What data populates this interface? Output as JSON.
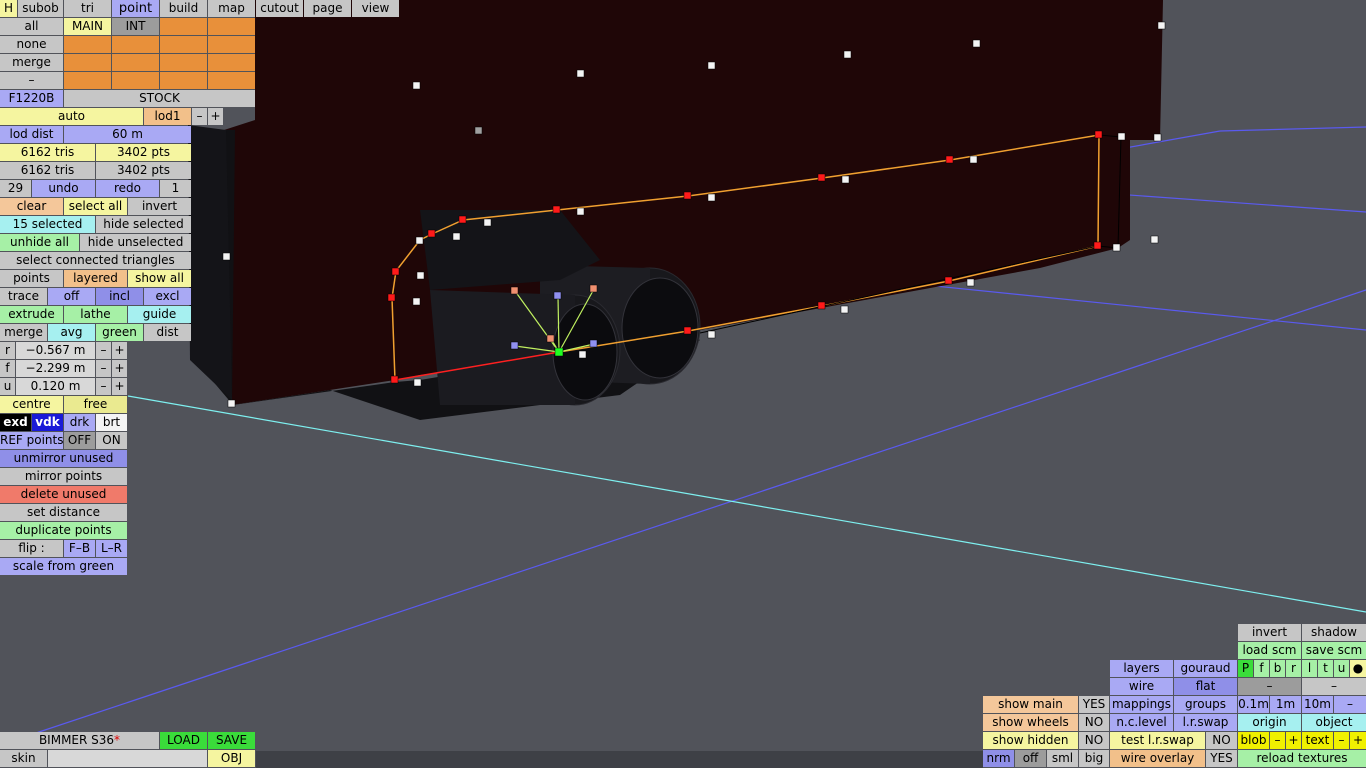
{
  "menu": {
    "items": [
      "H",
      "subob",
      "tri",
      "point",
      "build",
      "map",
      "cutout",
      "page",
      "view"
    ],
    "active": "point"
  },
  "left": {
    "sel_all": "all",
    "sel_none": "none",
    "sel_merge": "merge",
    "sel_minus": "–",
    "tab_main": "MAIN",
    "tab_int": "INT",
    "part_name": "F1220B",
    "part_type": "STOCK",
    "lod_auto": "auto",
    "lod_level": "lod1",
    "lod_minus": "–",
    "lod_plus": "+",
    "lod_dist_label": "lod dist",
    "lod_dist_value": "60 m",
    "tris1": "6162 tris",
    "pts1": "3402 pts",
    "tris2": "6162 tris",
    "pts2": "3402 pts",
    "undo_count": "29",
    "undo": "undo",
    "redo": "redo",
    "redo_count": "1",
    "clear": "clear",
    "select_all": "select all",
    "invert": "invert",
    "selected": "15 selected",
    "hide_selected": "hide selected",
    "unhide_all": "unhide all",
    "hide_unselected": "hide unselected",
    "select_connected": "select connected triangles",
    "points": "points",
    "layered": "layered",
    "show_all": "show all",
    "trace": "trace",
    "off": "off",
    "incl": "incl",
    "excl": "excl",
    "extrude": "extrude",
    "lathe": "lathe",
    "guide": "guide",
    "merge2": "merge",
    "avg": "avg",
    "green": "green",
    "dist": "dist",
    "coords": [
      {
        "axis": "r",
        "value": "−0.567 m"
      },
      {
        "axis": "f",
        "value": "−2.299 m"
      },
      {
        "axis": "u",
        "value": "0.120 m"
      }
    ],
    "pm_minus": "–",
    "pm_plus": "+",
    "centre": "centre",
    "free": "free",
    "exd": "exd",
    "vdk": "vdk",
    "drk": "drk",
    "brt": "brt",
    "ref_points": "REF points",
    "ref_off": "OFF",
    "ref_on": "ON",
    "unmirror_unused": "unmirror unused",
    "mirror_points": "mirror points",
    "delete_unused": "delete unused",
    "set_distance": "set distance",
    "duplicate_points": "duplicate points",
    "flip": "flip :",
    "fb": "F–B",
    "lr": "L–R",
    "scale_from_green": "scale from green"
  },
  "bottom_left": {
    "car_name": "BIMMER S36",
    "modified_mark": "*",
    "load": "LOAD",
    "save": "SAVE",
    "skin": "skin",
    "obj": "OBJ"
  },
  "bottom_right": {
    "invert": "invert",
    "shadow": "shadow",
    "load_scm": "load scm",
    "save_scm": "save scm",
    "toggles": [
      "P",
      "f",
      "b",
      "r",
      "l",
      "t",
      "u"
    ],
    "dot": "●",
    "layers": "layers",
    "gouraud": "gouraud",
    "wire": "wire",
    "flat": "flat",
    "dash1": "–",
    "dash2": "–",
    "show_main": "show main",
    "show_main_val": "YES",
    "mappings": "mappings",
    "groups": "groups",
    "g01": "0.1m",
    "g1": "1m",
    "g10": "10m",
    "gminus": "–",
    "show_wheels": "show wheels",
    "show_wheels_val": "NO",
    "nc_level": "n.c.level",
    "lr_swap": "l.r.swap",
    "origin": "origin",
    "object": "object",
    "show_hidden": "show hidden",
    "show_hidden_val": "NO",
    "test_lr_swap": "test l.r.swap",
    "test_lr_val": "NO",
    "blob": "blob",
    "text": "text",
    "nrm": "nrm",
    "off": "off",
    "sml": "sml",
    "big": "big",
    "wire_overlay": "wire overlay",
    "wire_overlay_val": "YES",
    "reload_textures": "reload textures"
  },
  "colors": {
    "background": "#51535a",
    "body_panel": "#1f0607",
    "selection_line": "#f0a030",
    "grid_blue": "#5a5af0",
    "grid_cyan": "#7ef0f0"
  }
}
